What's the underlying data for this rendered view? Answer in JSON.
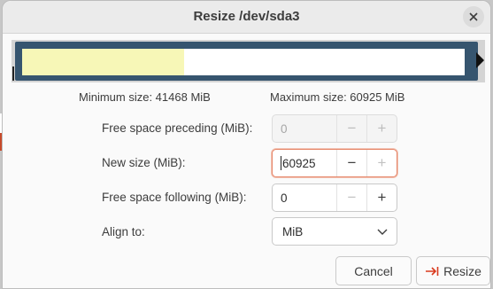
{
  "dialog": {
    "title": "Resize /dev/sda3"
  },
  "partition": {
    "used_fraction": 0.365,
    "used_color": "#f7f7b7",
    "border_color": "#36556f"
  },
  "sizes": {
    "minimum": "Minimum size: 41468 MiB",
    "maximum": "Maximum size: 60925 MiB"
  },
  "fields": {
    "free_preceding": {
      "label": "Free space preceding (MiB):",
      "value": "0"
    },
    "new_size": {
      "label": "New size (MiB):",
      "value": "60925"
    },
    "free_following": {
      "label": "Free space following (MiB):",
      "value": "0"
    },
    "align": {
      "label": "Align to:",
      "value": "MiB"
    }
  },
  "buttons": {
    "minus": "−",
    "plus": "+",
    "cancel": "Cancel",
    "resize": "Resize"
  },
  "icons": {
    "close": "close-icon",
    "chevron": "chevron-down-icon",
    "resize": "resize-arrow-icon"
  }
}
